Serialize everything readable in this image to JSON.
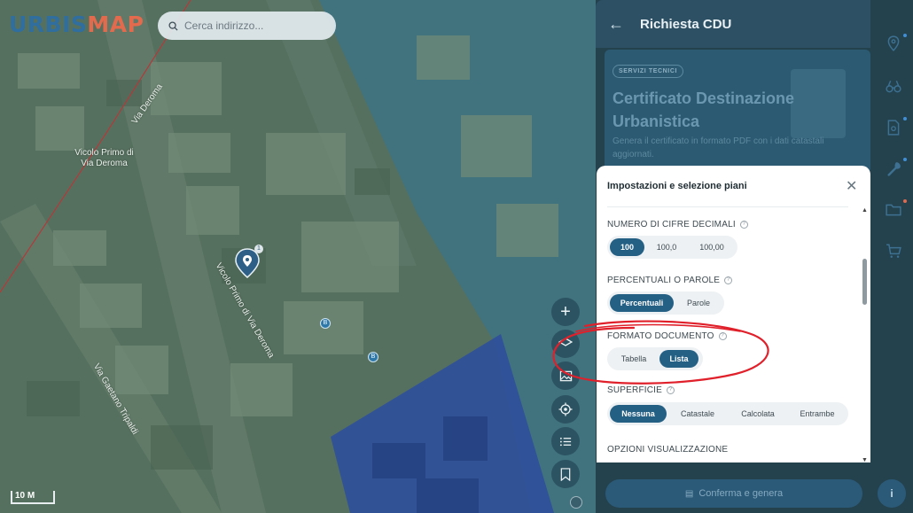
{
  "app": {
    "logo_part1": "URBIS",
    "logo_part2": "MAP",
    "logo_color1": "#2f6e9e",
    "logo_color2": "#e36a4c"
  },
  "search": {
    "placeholder": "Cerca indirizzo..."
  },
  "map": {
    "labels": [
      "Via Deroma",
      "Vicolo Primo di Via Deroma",
      "Vicolo Primo di Via Deroma",
      "Via Gaetano Tripaldi"
    ],
    "pin_badge": "1",
    "bus_stop": "B",
    "scale": "10 M",
    "controls": [
      "zoom-in",
      "layers",
      "image",
      "locate",
      "list",
      "bookmark"
    ]
  },
  "panel": {
    "back_icon": "arrow-left-icon",
    "title": "Richiesta CDU",
    "tag": "SERVIZI TECNICI",
    "heading": "Certificato Destinazione Urbanistica",
    "subtitle": "Genera il certificato in formato PDF con i dati catastali aggiornati.",
    "confirm_label": "Conferma e genera",
    "info_label": "i"
  },
  "sidebar": {
    "items": [
      {
        "icon": "location-pin-icon",
        "dot": "#3f8fd6"
      },
      {
        "icon": "binoculars-icon",
        "dot": ""
      },
      {
        "icon": "document-search-icon",
        "dot": "#3f8fd6"
      },
      {
        "icon": "wrench-icon",
        "dot": "#3f8fd6"
      },
      {
        "icon": "folder-icon",
        "dot": "#e36a4c"
      },
      {
        "icon": "cart-icon",
        "dot": ""
      }
    ]
  },
  "modal": {
    "title": "Impostazioni e selezione piani",
    "sections": [
      {
        "label": "NUMERO DI CIFRE DECIMALI",
        "options": [
          "100",
          "100,0",
          "100,00"
        ],
        "selected": "100"
      },
      {
        "label": "PERCENTUALI O PAROLE",
        "options": [
          "Percentuali",
          "Parole"
        ],
        "selected": "Percentuali"
      },
      {
        "label": "FORMATO DOCUMENTO",
        "options": [
          "Tabella",
          "Lista"
        ],
        "selected": "Lista"
      },
      {
        "label": "SUPERFICIE",
        "options": [
          "Nessuna",
          "Catastale",
          "Calcolata",
          "Entrambe"
        ],
        "selected": "Nessuna"
      },
      {
        "label": "OPZIONI VISUALIZZAZIONE"
      }
    ]
  },
  "colors": {
    "accent": "#245f84",
    "annotation": "#e0202a"
  }
}
